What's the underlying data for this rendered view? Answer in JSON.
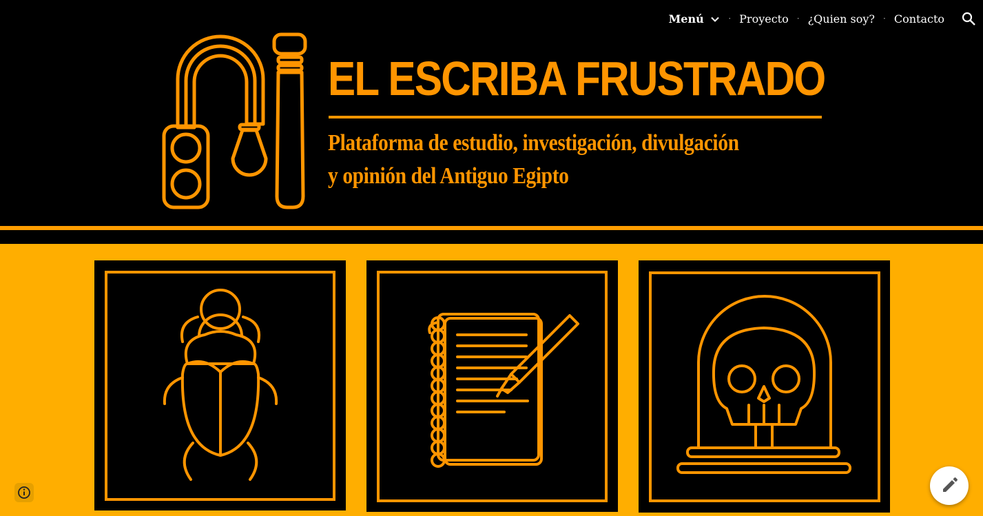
{
  "nav": {
    "menu_label": "Menú",
    "items": [
      "Proyecto",
      "¿Quien soy?",
      "Contacto"
    ]
  },
  "site": {
    "title": "EL ESCRIBA FRUSTRADO",
    "tagline_line1": "Plataforma de estudio, investigación, divulgación",
    "tagline_line2": "y opinión del Antiguo Egipto"
  },
  "icons": {
    "logo": "scribe-palette-logo",
    "card1": "scarab-icon",
    "card2": "notebook-pen-icon",
    "card3": "skull-dome-icon"
  },
  "colors": {
    "accent": "#ff9500",
    "section_bg": "#ffae00",
    "header_bg": "#000000"
  }
}
